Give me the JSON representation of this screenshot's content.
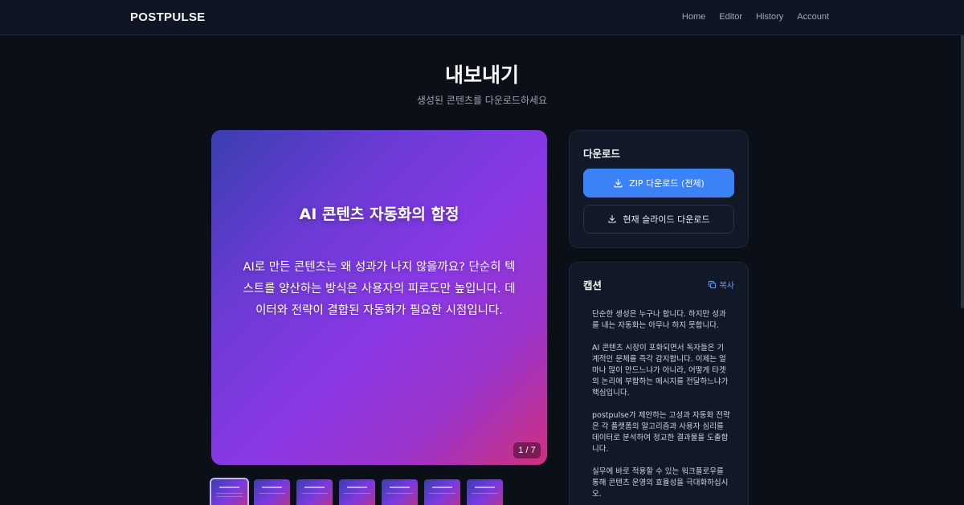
{
  "nav": {
    "brand": "POSTPULSE",
    "links": [
      "Home",
      "Editor",
      "History",
      "Account"
    ]
  },
  "header": {
    "title": "내보내기",
    "subtitle": "생성된 콘텐츠를 다운로드하세요"
  },
  "slide": {
    "title": "AI 콘텐츠 자동화의 함정",
    "body": "AI로 만든 콘텐츠는 왜 성과가 나지 않을까요? 단순히 텍스트를 양산하는 방식은 사용자의 피로도만 높입니다. 데이터와 전략이 결합된 자동화가 필요한 시점입니다.",
    "counter": "1 / 7",
    "gradient": [
      "#3a3fb0",
      "#8a38e6",
      "#d0307e"
    ]
  },
  "thumbnails": {
    "count": 7,
    "active_index": 0
  },
  "download": {
    "title": "다운로드",
    "zip_label": "ZIP 다운로드 (전체)",
    "current_label": "현재 슬라이드 다운로드",
    "icon": "download-icon",
    "accent": "#3b82f6"
  },
  "caption": {
    "title": "캡션",
    "copy_label": "복사",
    "copy_icon": "copy-icon",
    "paragraphs": [
      "단순한 생성은 누구나 합니다. 하지만 성과를 내는 자동화는 아무나 하지 못합니다.",
      "AI 콘텐츠 시장이 포화되면서 독자들은 기계적인 문체를 즉각 감지합니다. 이제는 얼마나 많이 만드느냐가 아니라, 어떻게 타겟의 논리에 부합하는 메시지를 전달하느냐가 핵심입니다.",
      "postpulse가 제안하는 고성과 자동화 전략은 각 플랫폼의 알고리즘과 사용자 심리를 데이터로 분석하여 정교한 결과물을 도출합니다.",
      "실무에 바로 적용할 수 있는 워크플로우를 통해 콘텐츠 운영의 효율성을 극대화하십시오."
    ]
  }
}
